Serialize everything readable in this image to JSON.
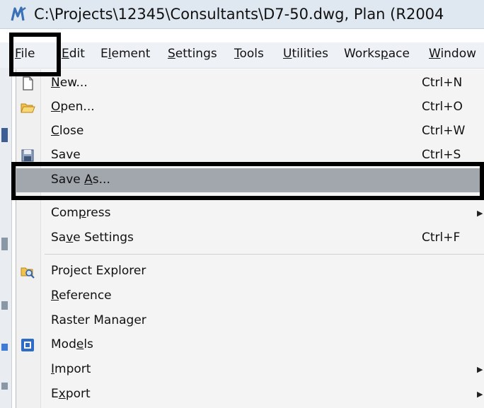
{
  "window": {
    "title": "C:\\Projects\\12345\\Consultants\\D7-50.dwg, Plan (R2004"
  },
  "menubar": {
    "items": [
      {
        "label": "File",
        "u": "F"
      },
      {
        "label": "Edit",
        "u": "E"
      },
      {
        "label": "Element",
        "u": "l"
      },
      {
        "label": "Settings",
        "u": "S"
      },
      {
        "label": "Tools",
        "u": "T"
      },
      {
        "label": "Utilities",
        "u": "U"
      },
      {
        "label": "Workspace",
        "u": "p"
      },
      {
        "label": "Window",
        "u": "W"
      }
    ]
  },
  "file_menu": {
    "items": [
      {
        "label": "New...",
        "u": "N",
        "shortcut": "Ctrl+N",
        "icon": "new-document-icon"
      },
      {
        "label": "Open...",
        "u": "O",
        "shortcut": "Ctrl+O",
        "icon": "open-folder-icon"
      },
      {
        "label": "Close",
        "u": "C",
        "shortcut": "Ctrl+W",
        "icon": ""
      },
      {
        "label": "Save",
        "u": "",
        "shortcut": "Ctrl+S",
        "icon": "save-disk-icon"
      },
      {
        "label": "Save As...",
        "u": "A",
        "shortcut": "",
        "icon": ""
      },
      {
        "label": "Compress",
        "u": "m",
        "shortcut": "",
        "icon": "",
        "submenu": true
      },
      {
        "label": "Save Settings",
        "u": "v",
        "shortcut": "Ctrl+F",
        "icon": ""
      },
      {
        "label": "Project Explorer",
        "u": "j",
        "shortcut": "",
        "icon": "project-explorer-icon"
      },
      {
        "label": "Reference",
        "u": "R",
        "shortcut": "",
        "icon": ""
      },
      {
        "label": "Raster Manager",
        "u": "g",
        "shortcut": "",
        "icon": ""
      },
      {
        "label": "Models",
        "u": "e",
        "shortcut": "",
        "icon": "models-icon"
      },
      {
        "label": "Import",
        "u": "I",
        "shortcut": "",
        "icon": "",
        "submenu": true
      },
      {
        "label": "Export",
        "u": "x",
        "shortcut": "",
        "icon": "",
        "submenu": true
      }
    ]
  },
  "colors": {
    "highlight": "#a2a7ad",
    "annotation": "#000000",
    "app_icon": "#3b6fb6",
    "folder": "#e8b33a",
    "models_icon": "#2f6cc8"
  }
}
